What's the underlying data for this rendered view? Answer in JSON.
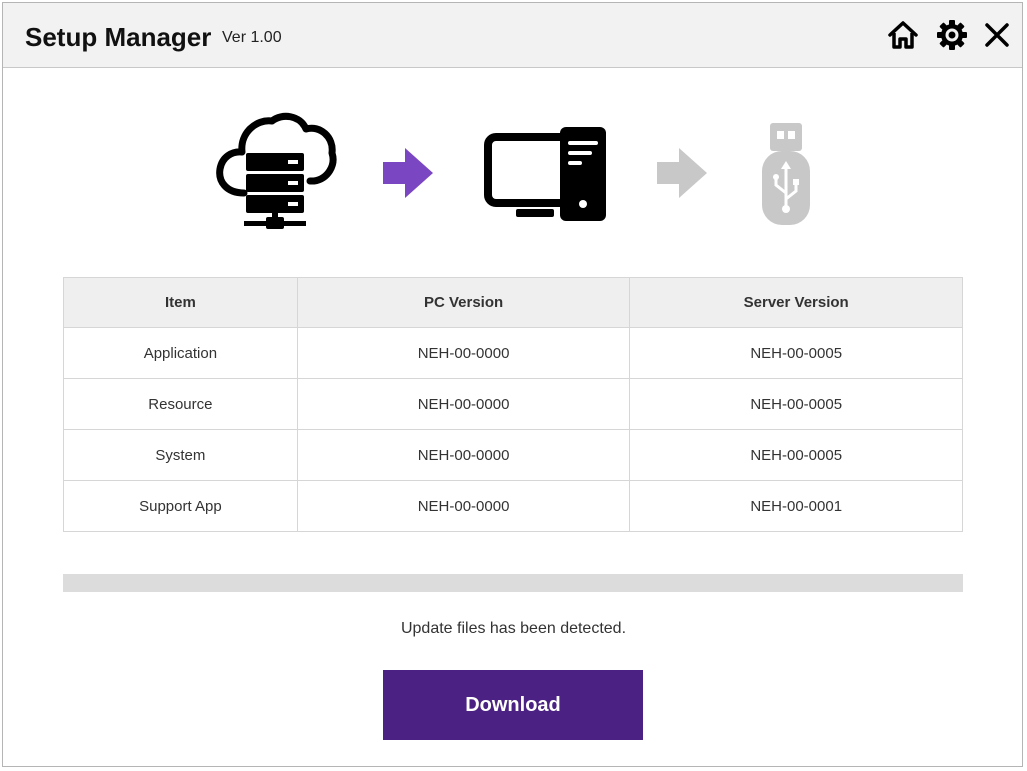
{
  "app": {
    "title": "Setup Manager",
    "version": "Ver 1.00"
  },
  "toolbar": {
    "icons": [
      "home-icon",
      "gear-icon",
      "close-icon"
    ]
  },
  "flow": {
    "steps": [
      "cloud-server-icon",
      "computer-icon",
      "usb-drive-icon"
    ],
    "active_arrow_color": "#7b46c1",
    "inactive_arrow_color": "#c8c8c8",
    "inactive_icon_color": "#c8c8c8"
  },
  "table": {
    "headers": [
      "Item",
      "PC Version",
      "Server Version"
    ],
    "rows": [
      [
        "Application",
        "NEH-00-0000",
        "NEH-00-0005"
      ],
      [
        "Resource",
        "NEH-00-0000",
        "NEH-00-0005"
      ],
      [
        "System",
        "NEH-00-0000",
        "NEH-00-0005"
      ],
      [
        "Support App",
        "NEH-00-0000",
        "NEH-00-0001"
      ]
    ]
  },
  "progress": {
    "value": 0
  },
  "status": "Update files has been detected.",
  "download_label": "Download",
  "colors": {
    "accent": "#4b2283",
    "titlebar": "#f2f2f2"
  }
}
